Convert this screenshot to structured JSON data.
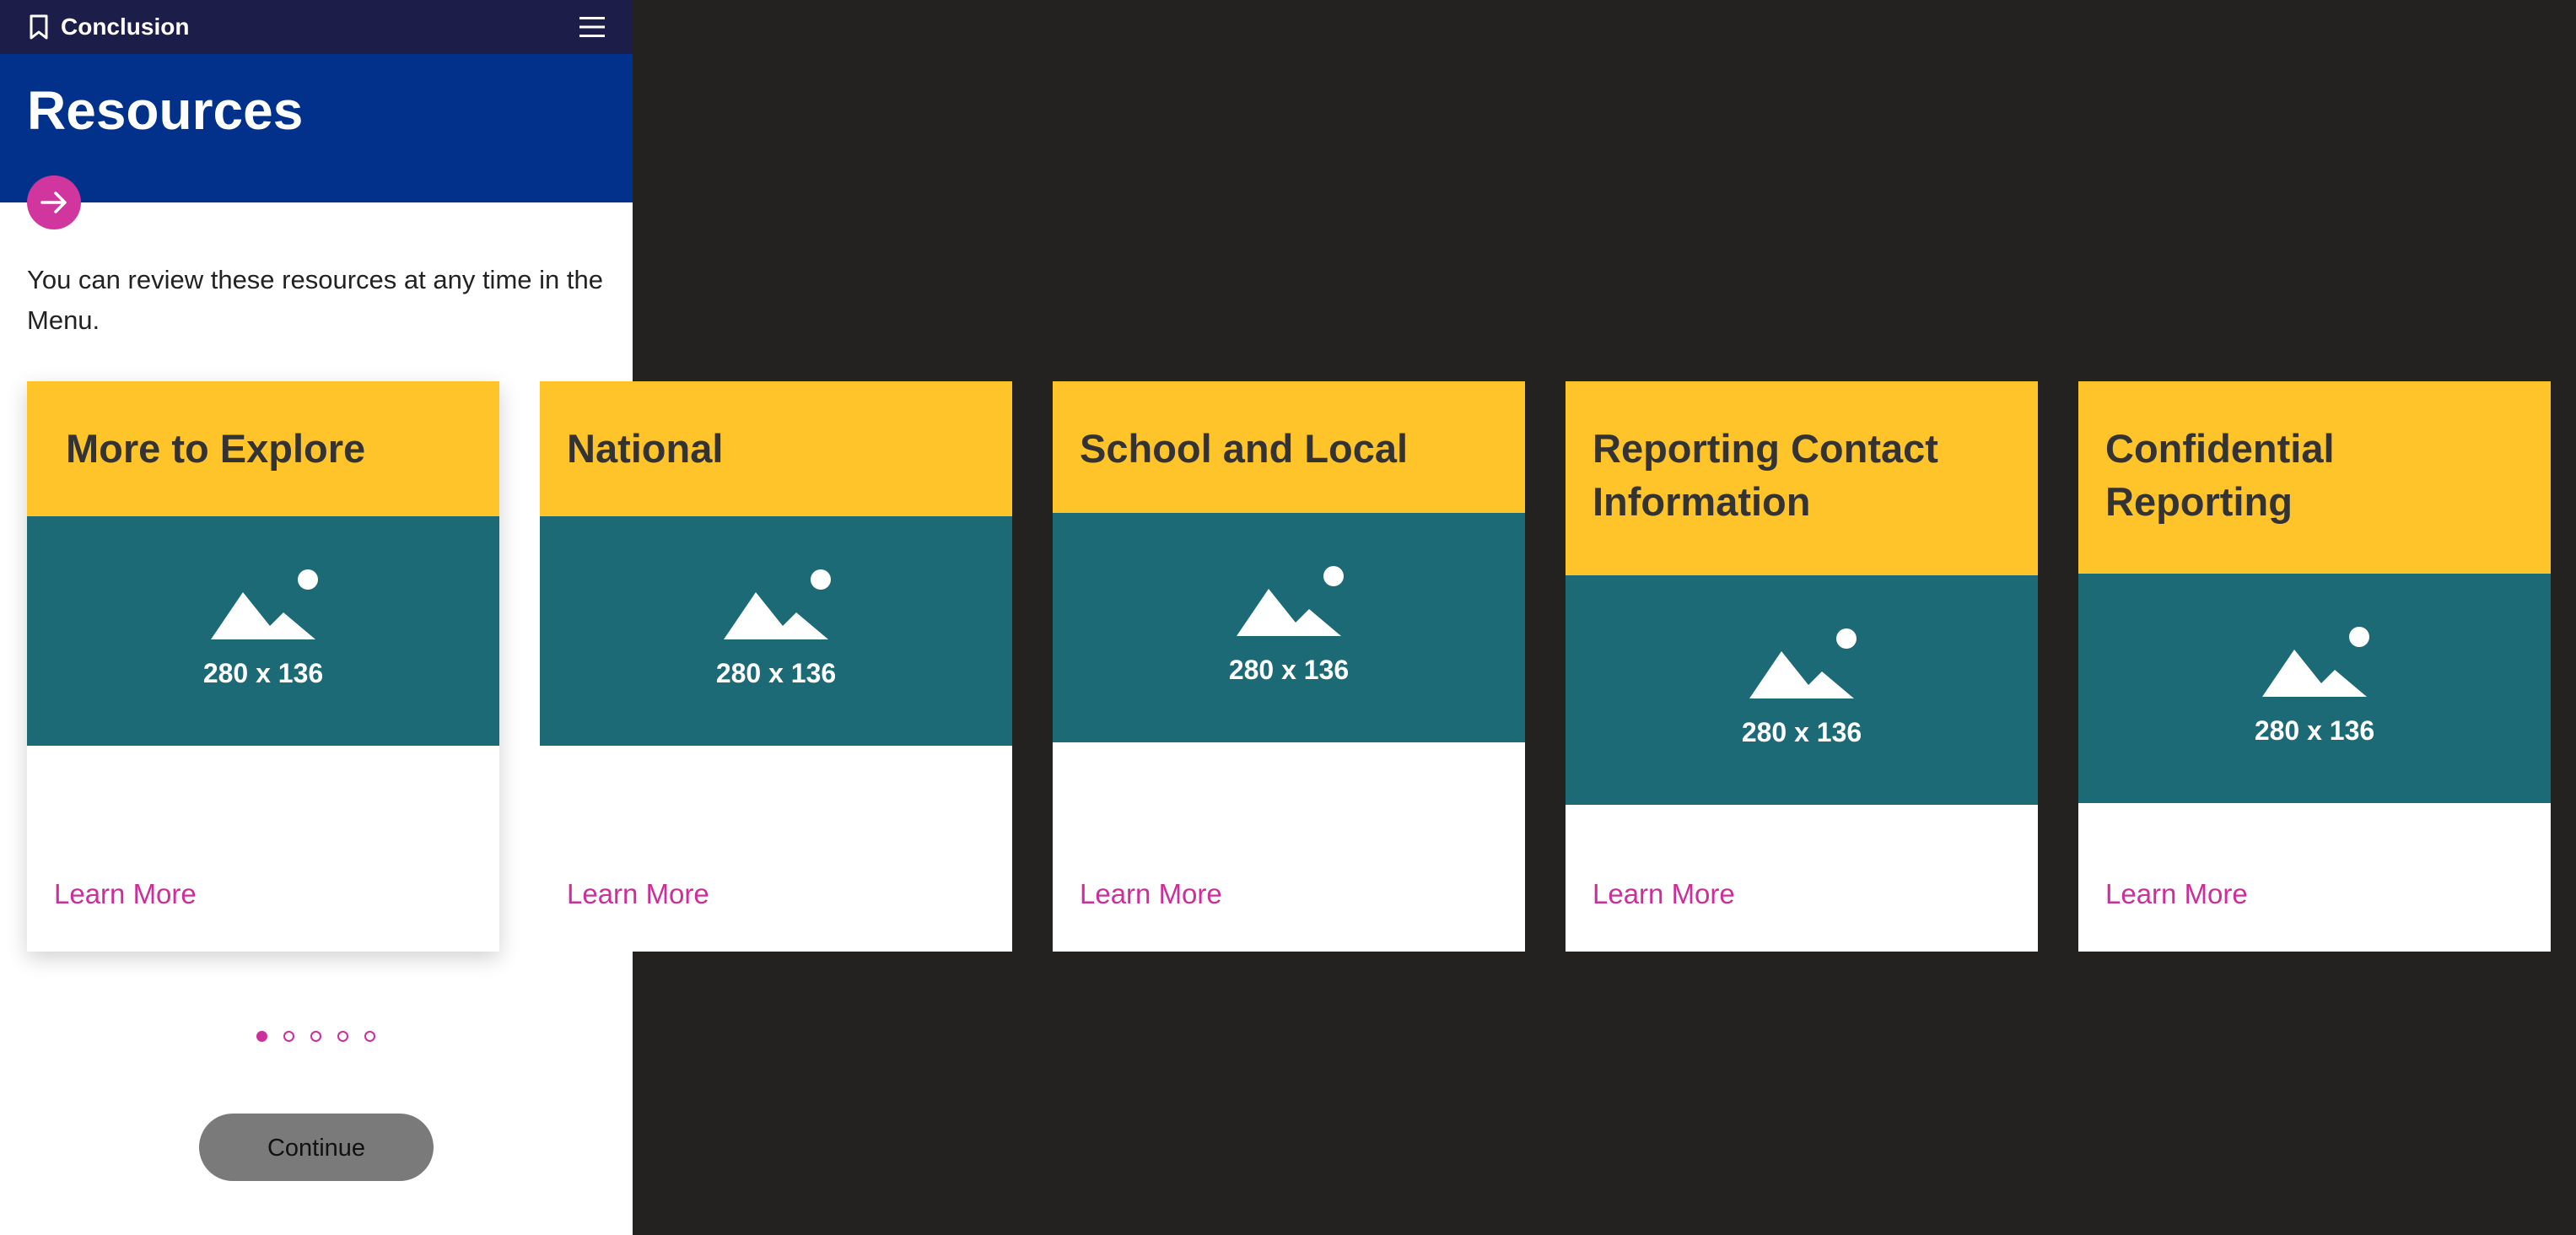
{
  "header": {
    "section_title": "Conclusion",
    "bookmark_icon": "bookmark-icon",
    "menu_icon": "hamburger-menu-icon"
  },
  "hero": {
    "title": "Resources",
    "arrow_icon": "arrow-right-icon"
  },
  "intro_text": "You can review these resources at any time in the Menu.",
  "cards": [
    {
      "title": "More to Explore",
      "image_label": "280 x 136",
      "link": "Learn More"
    },
    {
      "title": "National",
      "image_label": "280 x 136",
      "link": "Learn More"
    },
    {
      "title": "School and Local",
      "image_label": "280 x 136",
      "link": "Learn More"
    },
    {
      "title": "Reporting Contact Information",
      "image_label": "280 x 136",
      "link": "Learn More"
    },
    {
      "title": "Confidential Reporting",
      "image_label": "280 x 136",
      "link": "Learn More"
    }
  ],
  "pagination": {
    "total": 5,
    "active": 1
  },
  "continue_label": "Continue",
  "colors": {
    "topbar": "#1d1d4a",
    "hero": "#02318c",
    "accent": "#cc2f98",
    "card_header": "#fec42a",
    "card_image": "#1d6a77",
    "backdrop": "#232221"
  }
}
